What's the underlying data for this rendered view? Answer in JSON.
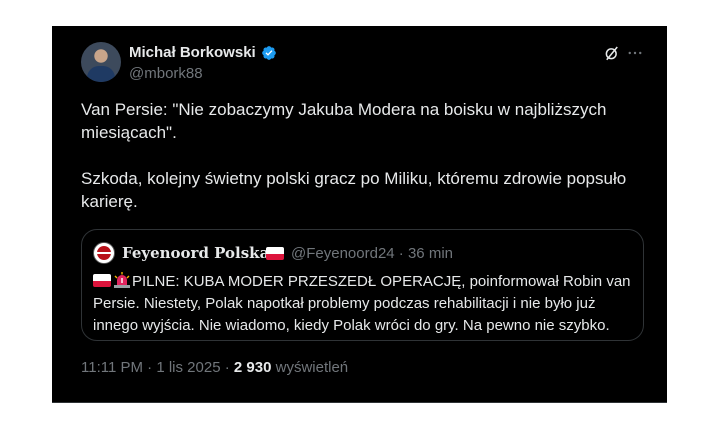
{
  "author": {
    "name": "Michał Borkowski",
    "handle": "@mbork88",
    "verified_icon": "verified-badge-icon"
  },
  "icons": {
    "grok": "grok-icon",
    "more": "more-options-icon"
  },
  "tweet": {
    "text": "Van Persie: \"Nie zobaczymy Jakuba Modera na boisku w najbliższych miesiącach\".\n\nSzkoda, kolejny świetny polski gracz po Miliku, któremu zdrowie popsuło karierę."
  },
  "quote": {
    "name": "Feyenoord Polska",
    "handle": "@Feyenoord24",
    "separator": "·",
    "time": "36 min",
    "text": "PILNE: KUBA MODER PRZESZEDŁ OPERACJĘ, poinformował Robin van Persie. Niestety, Polak napotkał problemy podczas rehabilitacji i nie było już innego wyjścia. Nie wiadomo, kiedy Polak wróci do gry. Na pewno nie szybko."
  },
  "meta": {
    "time": "11:11 PM",
    "date": "1 lis 2025",
    "separator": "·",
    "views_count": "2 930",
    "views_label": "wyświetleń"
  },
  "colors": {
    "background": "#000000",
    "text": "#e7e9ea",
    "muted": "#71767b",
    "verified": "#1d9bf0",
    "border": "#2f3336"
  }
}
